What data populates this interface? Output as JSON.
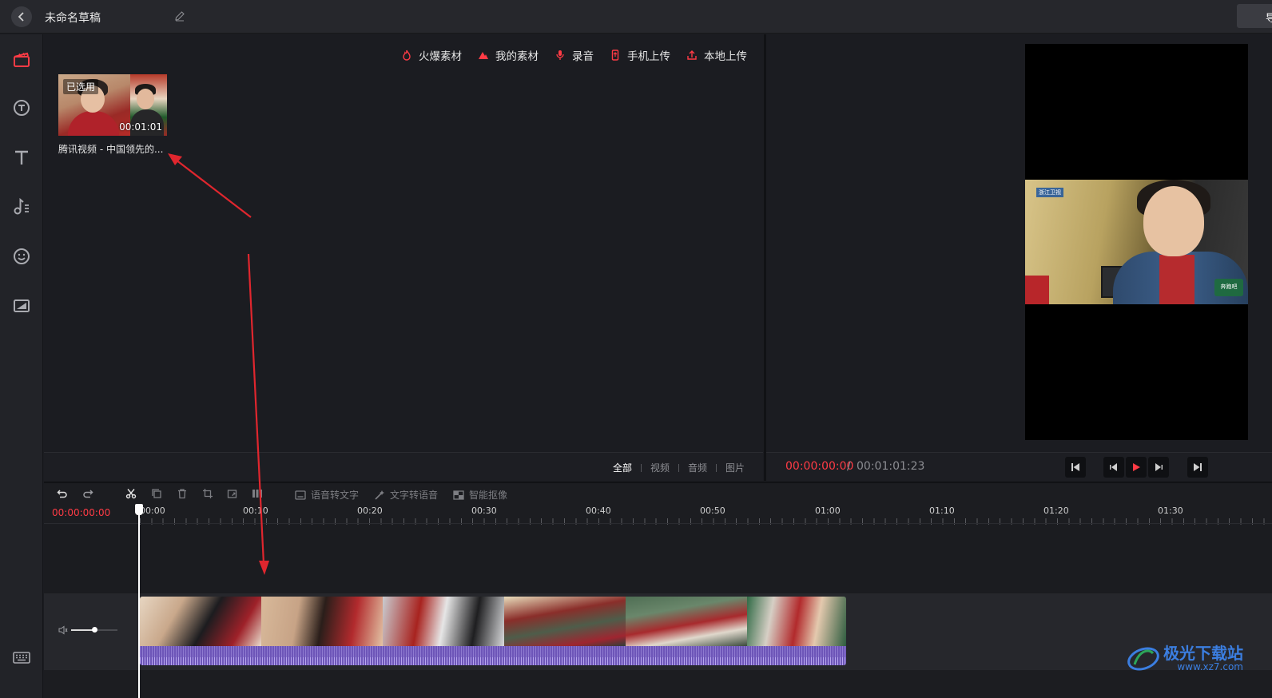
{
  "topbar": {
    "title": "未命名草稿",
    "export_label": "导"
  },
  "sidebar": {
    "items": [
      {
        "icon": "clapperboard-icon",
        "active": true
      },
      {
        "icon": "sticker-icon"
      },
      {
        "icon": "text-icon"
      },
      {
        "icon": "music-icon"
      },
      {
        "icon": "emoji-icon"
      },
      {
        "icon": "image-icon"
      }
    ],
    "bottom_icon": "keyboard-icon"
  },
  "media": {
    "tabs": [
      {
        "label": "火爆素材",
        "icon": "fire-icon"
      },
      {
        "label": "我的素材",
        "icon": "mountain-icon"
      },
      {
        "label": "录音",
        "icon": "microphone-icon"
      },
      {
        "label": "手机上传",
        "icon": "phone-upload-icon"
      },
      {
        "label": "本地上传",
        "icon": "upload-icon"
      }
    ],
    "item": {
      "selected_tag": "已选用",
      "duration": "00:01:01",
      "name": "腾讯视频 - 中国领先的..."
    },
    "filters": [
      "全部",
      "视频",
      "音频",
      "图片"
    ],
    "active_filter": "全部"
  },
  "preview": {
    "current_time": "00:00:00:00",
    "separator": "/",
    "total_time": "00:01:01:23",
    "frame_logo": "浙江卫视",
    "frame_badge": "奔跑吧"
  },
  "timeline": {
    "tools": {
      "undo": "undo-icon",
      "redo": "redo-icon",
      "cut": "scissors-icon",
      "copy": "copy-icon",
      "delete": "trash-icon",
      "crop": "crop-icon",
      "rotate": "rotate-icon",
      "split": "split-icon",
      "speech_to_text": "语音转文字",
      "text_to_speech": "文字转语音",
      "smart_matting": "智能抠像"
    },
    "time": "00:00:00:00",
    "ruler_labels": [
      "00:00",
      "00:10",
      "00:20",
      "00:30",
      "00:40",
      "00:50",
      "01:00",
      "01:10",
      "01:20",
      "01:30"
    ]
  },
  "watermark": {
    "brand": "极光下载站",
    "url": "www.xz7.com"
  },
  "colors": {
    "accent": "#ff3b45",
    "annotation": "#e0262e",
    "waveform": "#6d56b8"
  }
}
